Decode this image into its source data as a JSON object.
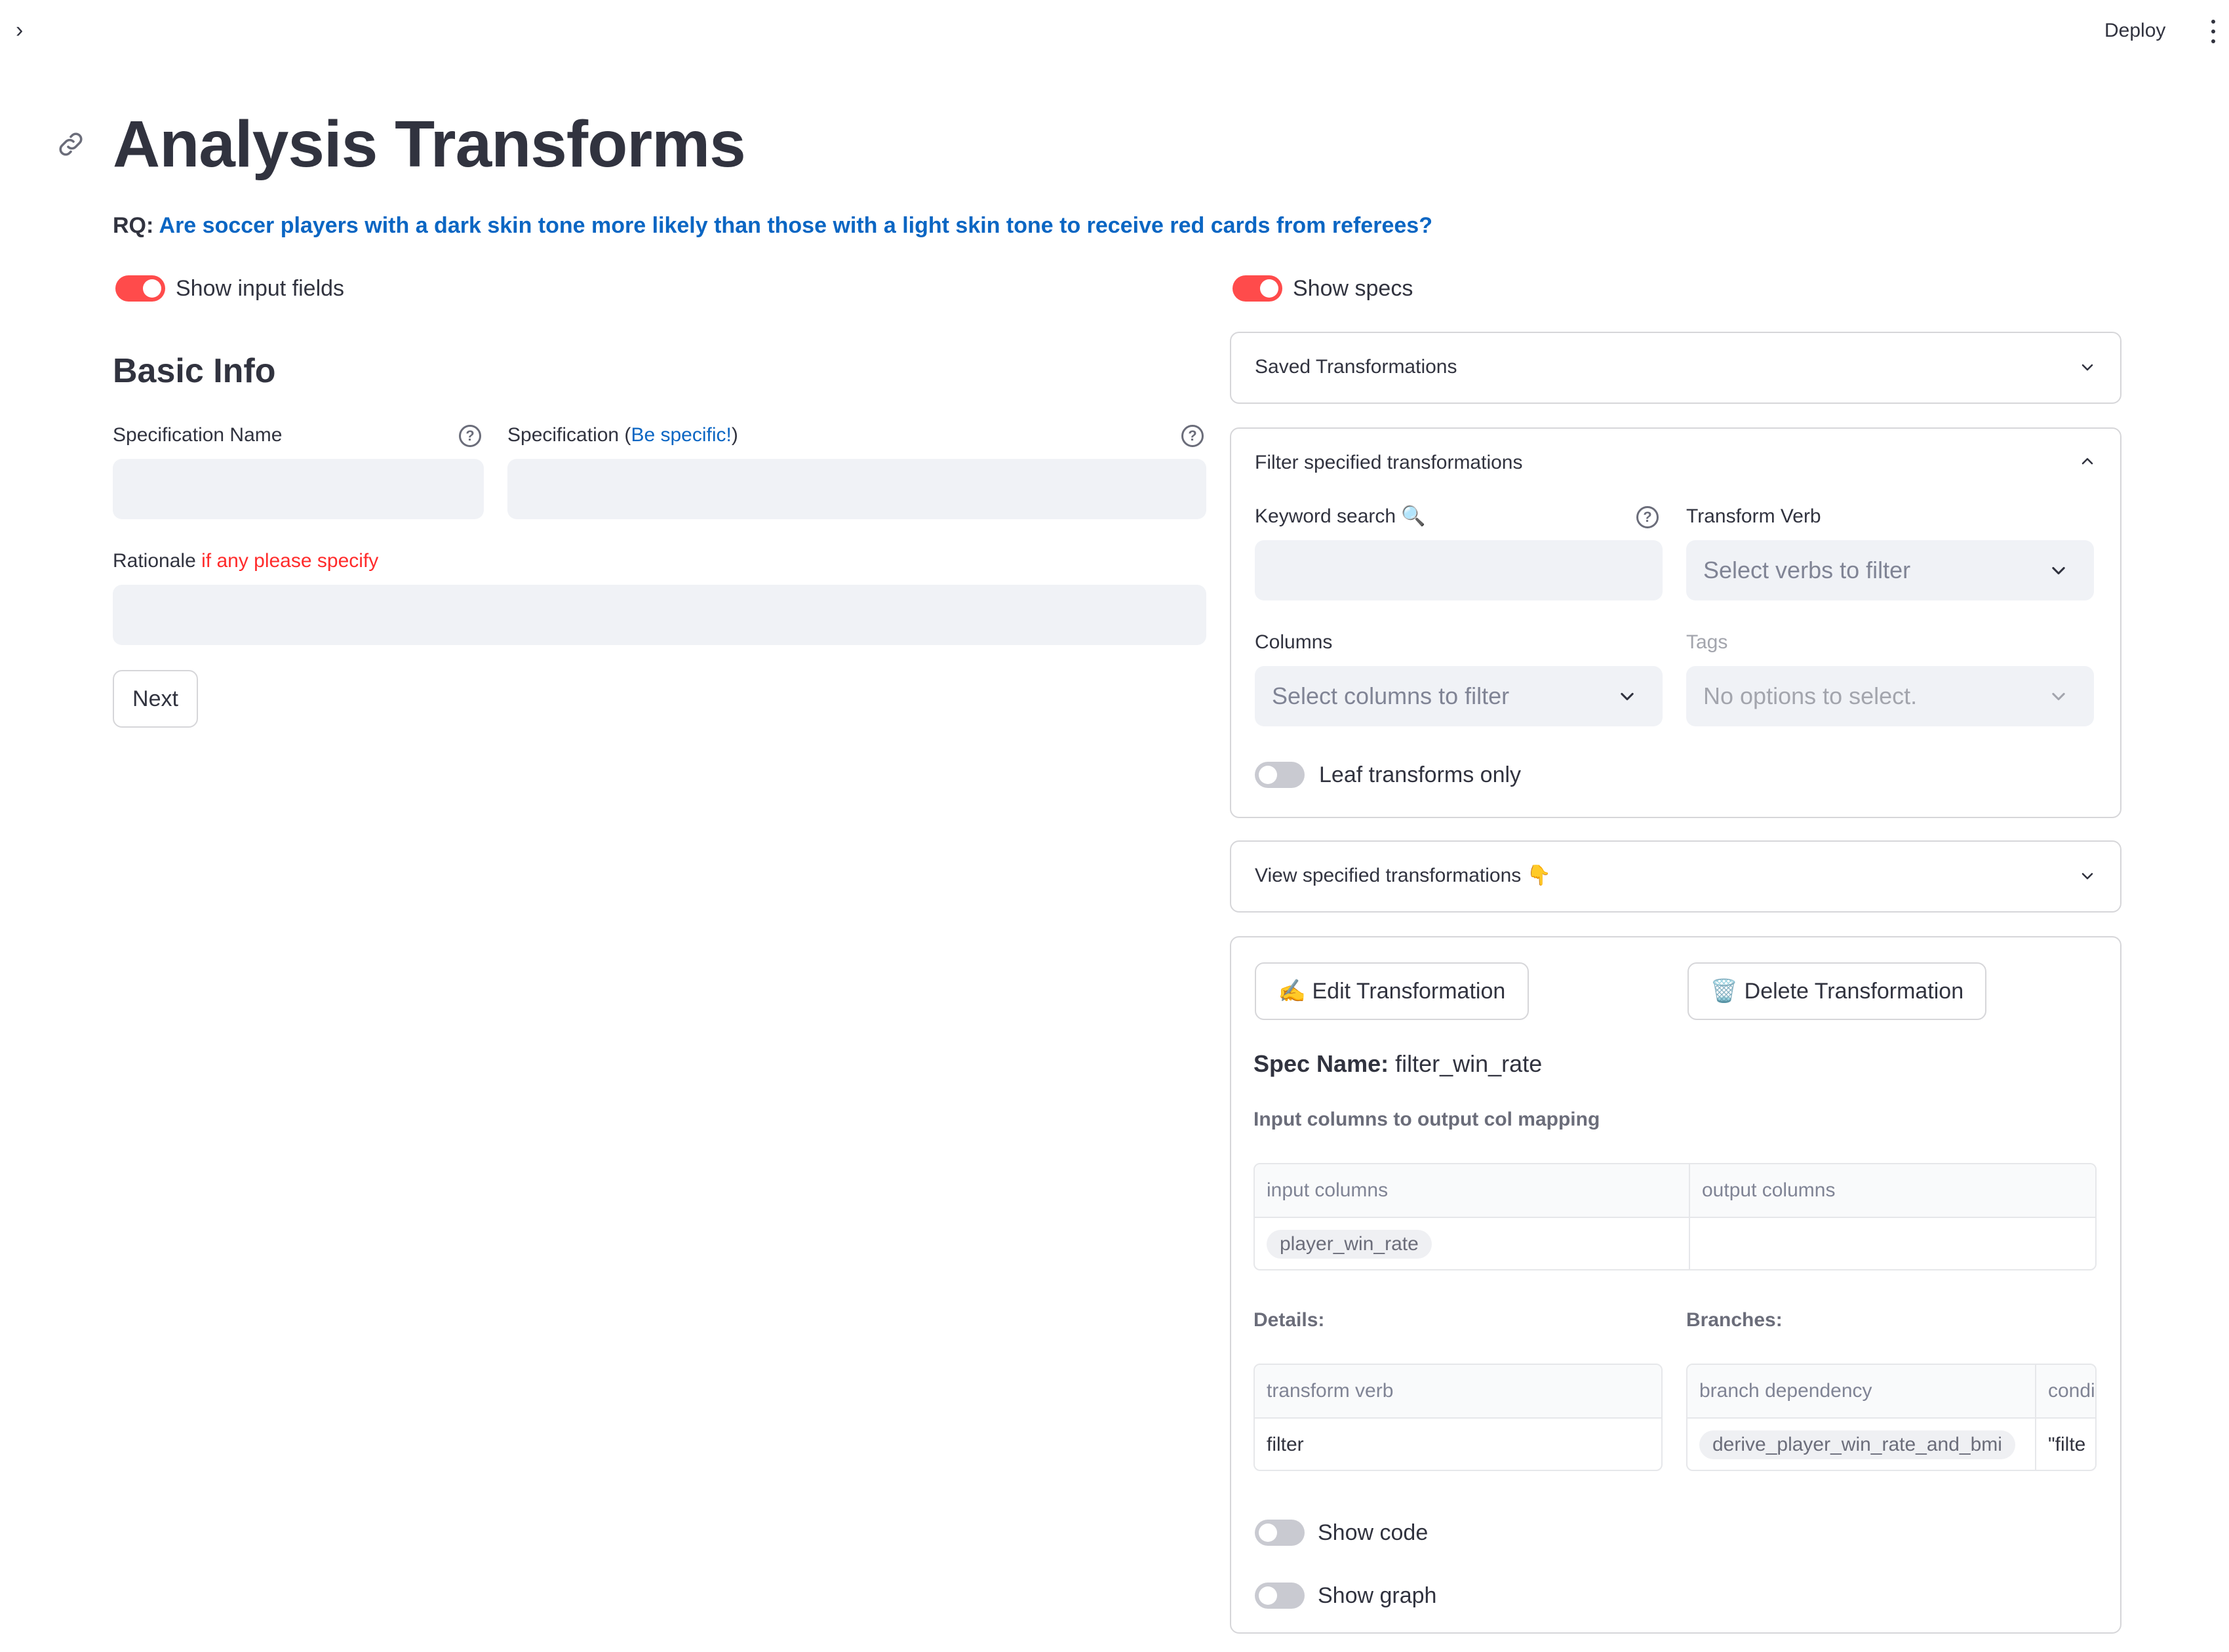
{
  "topbar": {
    "sidebar_toggle": "›",
    "deploy_label": "Deploy"
  },
  "page": {
    "title": "Analysis Transforms",
    "rq_label": "RQ:",
    "rq_question": "Are soccer players with a dark skin tone more likely than those with a light skin tone to receive red cards from referees?"
  },
  "left": {
    "show_input_fields_label": "Show input fields",
    "show_input_fields_on": true,
    "section_title": "Basic Info",
    "spec_name_label": "Specification Name",
    "spec_label": "Specification (",
    "spec_label_hint": "Be specific!",
    "spec_label_close": ")",
    "rationale_label": "Rationale",
    "rationale_hint": "if any please specify",
    "next_button": "Next",
    "help_glyph": "?"
  },
  "right": {
    "show_specs_label": "Show specs",
    "show_specs_on": true,
    "saved_transformations": "Saved Transformations",
    "filter_panel": {
      "title": "Filter specified transformations",
      "keyword_label": "Keyword search 🔍",
      "transform_verb_label": "Transform Verb",
      "transform_verb_placeholder": "Select verbs to filter",
      "columns_label": "Columns",
      "columns_placeholder": "Select columns to filter",
      "tags_label": "Tags",
      "tags_placeholder": "No options to select.",
      "leaf_only_label": "Leaf transforms only",
      "leaf_only_on": false
    },
    "view_specified": "View specified transformations 👇",
    "detail": {
      "edit_button": "✍️ Edit Transformation",
      "delete_button": "🗑️ Delete Transformation",
      "spec_name_label": "Spec Name:",
      "spec_name_value": "filter_win_rate",
      "mapping_title": "Input columns to output col mapping",
      "mapping_table": {
        "headers": [
          "input columns",
          "output columns"
        ],
        "rows": [
          [
            "player_win_rate",
            ""
          ]
        ]
      },
      "details_label": "Details:",
      "branches_label": "Branches:",
      "details_table": {
        "headers": [
          "transform verb"
        ],
        "rows": [
          [
            "filter"
          ]
        ]
      },
      "branches_table": {
        "headers": [
          "branch dependency",
          "condi"
        ],
        "rows": [
          [
            "derive_player_win_rate_and_bmi",
            "\"filte"
          ]
        ]
      },
      "show_code_label": "Show code",
      "show_graph_label": "Show graph"
    }
  },
  "colors": {
    "accent": "#ff4b4b",
    "link_blue": "#0b66c3",
    "hint_red": "#ff2b2b",
    "input_bg": "#f0f2f6"
  },
  "icons": [
    "chevron-right-icon",
    "kebab-menu-icon",
    "link-icon",
    "help-icon",
    "chevron-down-icon",
    "chevron-up-icon"
  ]
}
